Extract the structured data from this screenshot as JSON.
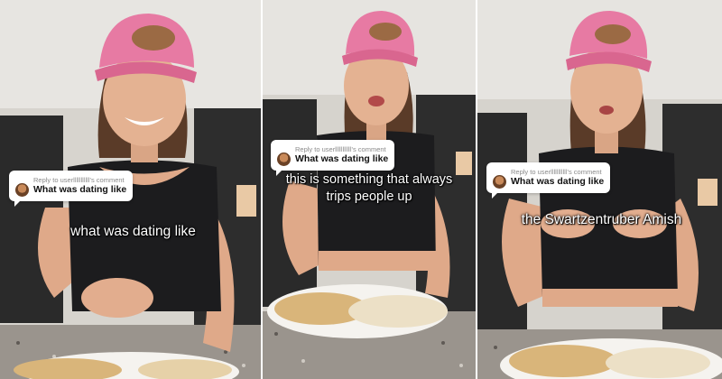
{
  "frames": [
    {
      "reply_label": "Reply to userlllllllllll's comment",
      "question": "What was dating like",
      "caption": "what was dating like"
    },
    {
      "reply_label": "Reply to userlllllllllll's comment",
      "question": "What was dating like",
      "caption_line1": "this is something that always",
      "caption_line2": "trips people up"
    },
    {
      "reply_label": "Reply to userlllllllllll's comment",
      "question": "What was dating like",
      "caption": "the Swartzentruber Amish"
    }
  ],
  "colors": {
    "cap_pink": "#e77aa3",
    "cap_patch": "#9b6a44",
    "top_black": "#1c1c1e",
    "skin": "#e2b08f",
    "kitchen_wall": "#d9d6d0",
    "cabinet_dark": "#2b2b2b",
    "counter_granite": "#8f8a84"
  }
}
